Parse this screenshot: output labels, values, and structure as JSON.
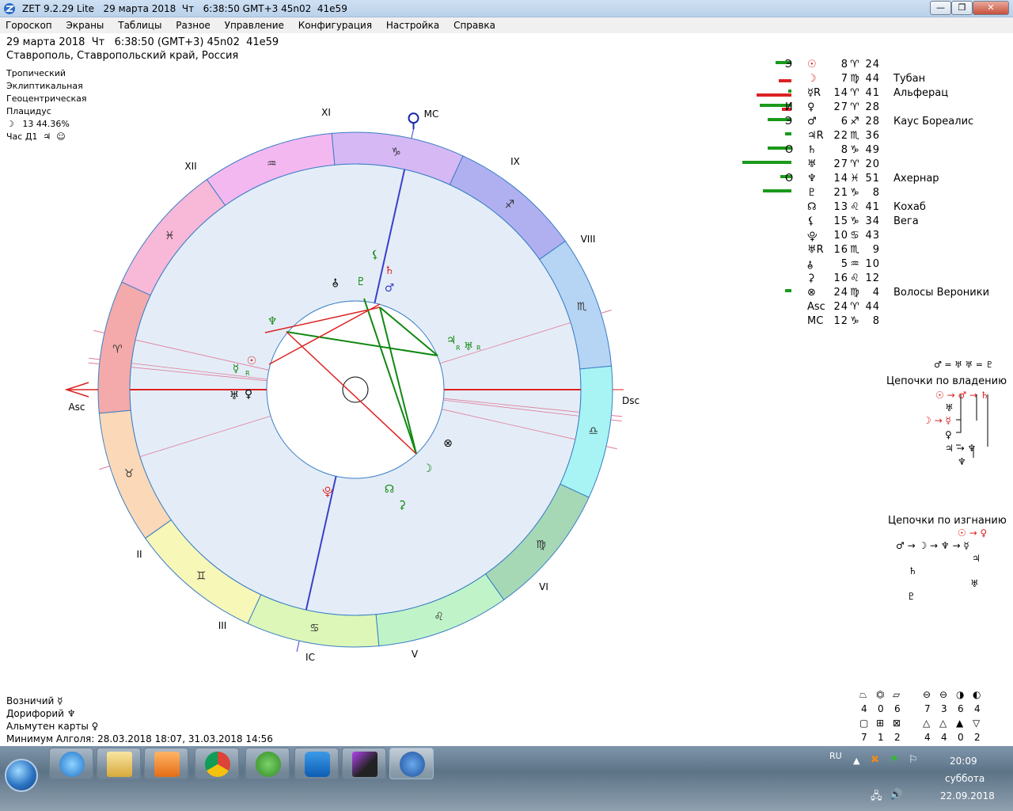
{
  "window": {
    "title": "ZET 9.2.29 Lite   29 марта 2018  Чт   6:38:50 GMT+3 45n02  41e59",
    "min_label": "—",
    "max_label": "❐",
    "close_label": "✕"
  },
  "menu": [
    "Гороскоп",
    "Экраны",
    "Таблицы",
    "Разное",
    "Управление",
    "Конфигурация",
    "Настройка",
    "Справка"
  ],
  "header": {
    "line1": "29 марта 2018  Чт   6:38:50 (GMT+3) 45n02  41e59",
    "line2": "Ставрополь, Ставропольский край, Россия"
  },
  "settings": {
    "items": [
      "Тропический",
      "Эклиптикальная",
      "Геоцентрическая",
      "Плацидус"
    ],
    "moon": "☽   13 44.36%",
    "hour": "Час Д1  ♃  ☺"
  },
  "houses": [
    "Asc",
    "II",
    "III",
    "IC",
    "V",
    "VI",
    "Dsc",
    "VIII",
    "IX",
    "MC",
    "XI",
    "XII"
  ],
  "signs": [
    "♈",
    "♉",
    "♊",
    "♋",
    "♌",
    "♍",
    "♎",
    "♏",
    "♐",
    "♑",
    "♒",
    "♓"
  ],
  "colors": {
    "ring_bg": "#e4edf7",
    "red": "#dd2222",
    "green": "#118811",
    "blue": "#2233aa",
    "sign_colors": [
      "#f4aaaa",
      "#fad8b8",
      "#f7f7b8",
      "#dcf7b8",
      "#c0f4c8",
      "#a6d8b6",
      "#a8f4f4",
      "#b6d4f4",
      "#b0b0f0",
      "#d6b8f4",
      "#f4b8f0",
      "#f8b8d8"
    ]
  },
  "chart_labels": {
    "tr": "R"
  },
  "planets": [
    {
      "glyph": "☉",
      "ret": "Э",
      "degree": "8",
      "sign": "♈",
      "minute": "24",
      "star": "",
      "bar_green": 20,
      "bar_red": 0,
      "color": "#dd2222"
    },
    {
      "glyph": "☽",
      "ret": "",
      "degree": "7",
      "sign": "♍",
      "minute": "44",
      "star": "Тубан",
      "bar_green": 0,
      "bar_red": 16,
      "color": "#dd2222"
    },
    {
      "glyph": "☿R",
      "ret": "",
      "degree": "14",
      "sign": "♈",
      "minute": "41",
      "star": "Альферац",
      "bar_green": 4,
      "bar_red": 44,
      "color": "#000000"
    },
    {
      "glyph": "♀",
      "ret": "И",
      "degree": "27",
      "sign": "♈",
      "minute": "28",
      "star": "",
      "bar_green": 40,
      "bar_red": 12,
      "color": "#000000"
    },
    {
      "glyph": "♂",
      "ret": "Э",
      "degree": "6",
      "sign": "♐",
      "minute": "28",
      "star": "Каус Бореалис",
      "bar_green": 30,
      "bar_red": 0,
      "color": "#000000"
    },
    {
      "glyph": "♃R",
      "ret": "",
      "degree": "22",
      "sign": "♏",
      "minute": "36",
      "star": "",
      "bar_green": 8,
      "bar_red": 0,
      "color": "#000000"
    },
    {
      "glyph": "♄",
      "ret": "О",
      "degree": "8",
      "sign": "♑",
      "minute": "49",
      "star": "",
      "bar_green": 30,
      "bar_red": 0,
      "color": "#000000"
    },
    {
      "glyph": "♅",
      "ret": "",
      "degree": "27",
      "sign": "♈",
      "minute": "20",
      "star": "",
      "bar_green": 62,
      "bar_red": 0,
      "color": "#000000"
    },
    {
      "glyph": "♆",
      "ret": "О",
      "degree": "14",
      "sign": "♓",
      "minute": "51",
      "star": "Ахернар",
      "bar_green": 14,
      "bar_red": 0,
      "color": "#000000"
    },
    {
      "glyph": "♇",
      "ret": "",
      "degree": "21",
      "sign": "♑",
      "minute": "8",
      "star": "",
      "bar_green": 36,
      "bar_red": 0,
      "color": "#000000"
    },
    {
      "glyph": "☊",
      "ret": "",
      "degree": "13",
      "sign": "♌",
      "minute": "41",
      "star": "Кохаб",
      "bar_green": 0,
      "bar_red": 0,
      "color": "#000000"
    },
    {
      "glyph": "⚸",
      "ret": "",
      "degree": "15",
      "sign": "♑",
      "minute": "34",
      "star": "Вега",
      "bar_green": 0,
      "bar_red": 0,
      "color": "#000000"
    },
    {
      "glyph": "⯓",
      "ret": "",
      "degree": "10",
      "sign": "♋",
      "minute": "43",
      "star": "",
      "bar_green": 0,
      "bar_red": 0,
      "color": "#000000"
    },
    {
      "glyph": "♅R",
      "ret": "",
      "degree": "16",
      "sign": "♏",
      "minute": "9",
      "star": "",
      "bar_green": 0,
      "bar_red": 0,
      "color": "#000000"
    },
    {
      "glyph": "⯗",
      "ret": "",
      "degree": "5",
      "sign": "♒",
      "minute": "10",
      "star": "",
      "bar_green": 0,
      "bar_red": 0,
      "color": "#000000"
    },
    {
      "glyph": "⚳",
      "ret": "",
      "degree": "16",
      "sign": "♌",
      "minute": "12",
      "star": "",
      "bar_green": 0,
      "bar_red": 0,
      "color": "#000000"
    },
    {
      "glyph": "⊗",
      "ret": "",
      "degree": "24",
      "sign": "♍",
      "minute": "4",
      "star": "Волосы Вероники",
      "bar_green": 8,
      "bar_red": 0,
      "color": "#000000"
    },
    {
      "glyph": "Asc",
      "ret": "",
      "degree": "24",
      "sign": "♈",
      "minute": "44",
      "star": "",
      "bar_green": 0,
      "bar_red": 0,
      "color": "#000000"
    },
    {
      "glyph": "MC",
      "ret": "",
      "degree": "12",
      "sign": "♑",
      "minute": "8",
      "star": "",
      "bar_green": 0,
      "bar_red": 0,
      "color": "#000000"
    }
  ],
  "chains": {
    "equal": "♂ = ♅ ♅ = ♇",
    "rulership_title": "Цепочки по владению",
    "rulership": [
      "☉ → ♂ → ♄",
      "♅",
      "☽ → ☿",
      "♀",
      "♃ → ♆",
      "♆"
    ],
    "exile_title": "Цепочки по изгнанию",
    "exile": [
      "☉ → ♀",
      "♂ → ☽ → ♆ → ☿",
      "♃",
      "♄",
      "♅",
      "♇"
    ]
  },
  "bottom": {
    "rising": "Возничий  ☿",
    "doryphory": "Дорифорий  ♆",
    "almuten": "Альмутен карты  ♀",
    "algol": "Минимум Алголя: 28.03.2018 18:07,  31.03.2018 14:56"
  },
  "aspect_counts": {
    "row1_symbols": [
      "⏢",
      "⏣",
      "⏥",
      "⊖",
      "⊖",
      "◑",
      "◐"
    ],
    "row1_values": [
      "4",
      "0",
      "6",
      "7",
      "3",
      "6",
      "4"
    ],
    "row2_symbols": [
      "▢",
      "⊞",
      "⊠",
      "△",
      "△",
      "▲",
      "▽"
    ],
    "row2_values": [
      "7",
      "1",
      "2",
      "4",
      "4",
      "0",
      "2"
    ]
  },
  "taskbar": {
    "lang": "RU",
    "time": "20:09",
    "day": "суббота",
    "date": "22.09.2018"
  }
}
